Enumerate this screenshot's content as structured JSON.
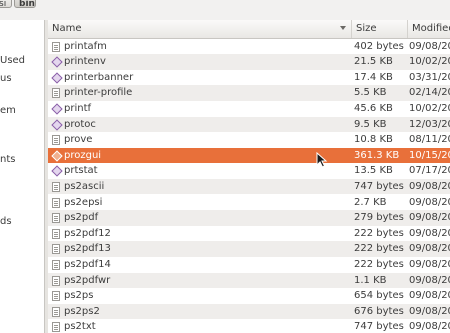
{
  "pathbar": {
    "prev_label": "si",
    "current_label": "bin"
  },
  "sidebar": {
    "items": [
      "Used",
      "us",
      "em",
      "nts",
      "ds"
    ]
  },
  "columns": {
    "name": "Name",
    "size": "Size",
    "modified": "Modified"
  },
  "rows": [
    {
      "name": "printafm",
      "size": "402 bytes",
      "modified": "09/08/20",
      "icon": "text-file-icon",
      "selected": false
    },
    {
      "name": "printenv",
      "size": "21.5 KB",
      "modified": "10/02/20",
      "icon": "executable-icon",
      "selected": false
    },
    {
      "name": "printerbanner",
      "size": "17.4 KB",
      "modified": "03/31/20",
      "icon": "executable-icon",
      "selected": false
    },
    {
      "name": "printer-profile",
      "size": "5.5 KB",
      "modified": "02/14/20",
      "icon": "text-file-icon",
      "selected": false
    },
    {
      "name": "printf",
      "size": "45.6 KB",
      "modified": "10/02/20",
      "icon": "executable-icon",
      "selected": false
    },
    {
      "name": "protoc",
      "size": "9.5 KB",
      "modified": "12/03/20",
      "icon": "executable-icon",
      "selected": false
    },
    {
      "name": "prove",
      "size": "10.8 KB",
      "modified": "08/11/20",
      "icon": "text-file-icon",
      "selected": false
    },
    {
      "name": "prozgui",
      "size": "361.3 KB",
      "modified": "10/15/20",
      "icon": "executable-icon",
      "selected": true
    },
    {
      "name": "prtstat",
      "size": "13.5 KB",
      "modified": "07/17/20",
      "icon": "executable-icon",
      "selected": false
    },
    {
      "name": "ps2ascii",
      "size": "747 bytes",
      "modified": "09/08/20",
      "icon": "text-file-icon",
      "selected": false
    },
    {
      "name": "ps2epsi",
      "size": "2.7 KB",
      "modified": "09/08/20",
      "icon": "text-file-icon",
      "selected": false
    },
    {
      "name": "ps2pdf",
      "size": "279 bytes",
      "modified": "09/08/20",
      "icon": "text-file-icon",
      "selected": false
    },
    {
      "name": "ps2pdf12",
      "size": "222 bytes",
      "modified": "09/08/20",
      "icon": "text-file-icon",
      "selected": false
    },
    {
      "name": "ps2pdf13",
      "size": "222 bytes",
      "modified": "09/08/20",
      "icon": "text-file-icon",
      "selected": false
    },
    {
      "name": "ps2pdf14",
      "size": "222 bytes",
      "modified": "09/08/20",
      "icon": "text-file-icon",
      "selected": false
    },
    {
      "name": "ps2pdfwr",
      "size": "1.1 KB",
      "modified": "09/08/20",
      "icon": "text-file-icon",
      "selected": false
    },
    {
      "name": "ps2ps",
      "size": "654 bytes",
      "modified": "09/08/20",
      "icon": "text-file-icon",
      "selected": false
    },
    {
      "name": "ps2ps2",
      "size": "676 bytes",
      "modified": "09/08/20",
      "icon": "text-file-icon",
      "selected": false
    },
    {
      "name": "ps2txt",
      "size": "747 bytes",
      "modified": "09/08/20",
      "icon": "text-file-icon",
      "selected": false
    }
  ],
  "colors": {
    "selection": "#e8703a",
    "alt_row": "#efedeb",
    "exec_icon": "#8a5fa8"
  }
}
